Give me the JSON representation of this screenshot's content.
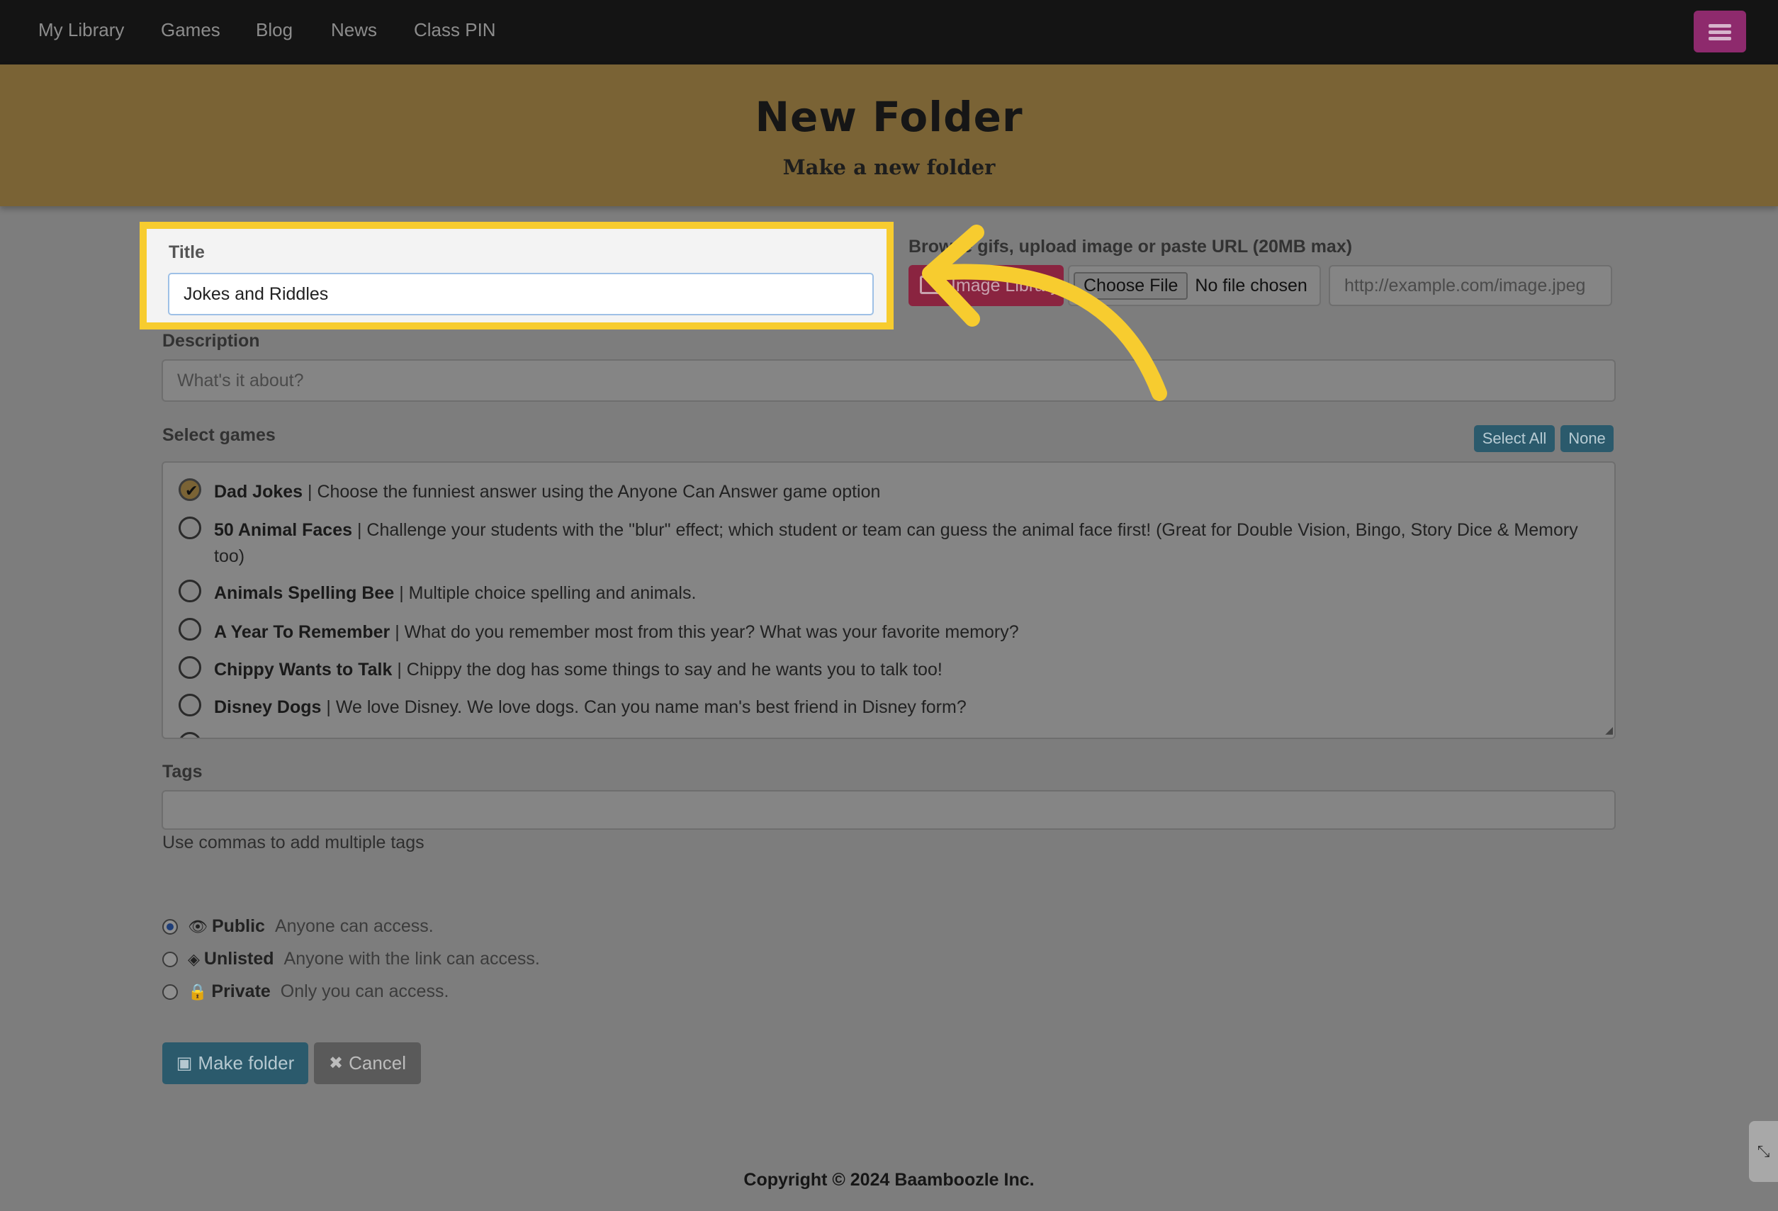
{
  "nav": {
    "items": [
      "My Library",
      "Games",
      "Blog",
      "News",
      "Class PIN"
    ]
  },
  "banner": {
    "title": "New Folder",
    "subtitle": "Make a new folder"
  },
  "form": {
    "title_label": "Title",
    "title_value": "Jokes and Riddles",
    "image_label": "Browse gifs, upload image or paste URL (20MB max)",
    "image_library_label": "Image Library",
    "choose_file_label": "Choose File",
    "no_file_label": "No file chosen",
    "url_placeholder": "http://example.com/image.jpeg",
    "description_label": "Description",
    "description_placeholder": "What's it about?",
    "select_games_label": "Select games",
    "select_all_label": "Select All",
    "none_label": "None",
    "games": [
      {
        "name": "Dad Jokes",
        "desc": " | Choose the funniest answer using the Anyone Can Answer game option",
        "checked": true
      },
      {
        "name": "50 Animal Faces",
        "desc": " | Challenge your students with the \"blur\" effect; which student or team can guess the animal face first! (Great for Double Vision, Bingo, Story Dice & Memory too)",
        "checked": false
      },
      {
        "name": "Animals Spelling Bee",
        "desc": " | Multiple choice spelling and animals.",
        "checked": false
      },
      {
        "name": "A Year To Remember",
        "desc": " | What do you remember most from this year? What was your favorite memory?",
        "checked": false
      },
      {
        "name": "Chippy Wants to Talk",
        "desc": " | Chippy the dog has some things to say and he wants you to talk too!",
        "checked": false
      },
      {
        "name": "Disney Dogs",
        "desc": " | We love Disney. We love dogs. Can you name man's best friend in Disney form?",
        "checked": false
      }
    ],
    "tags_label": "Tags",
    "tags_hint": "Use commas to add multiple tags",
    "visibility": [
      {
        "name": "Public",
        "desc": "Anyone can access.",
        "icon": "eye-icon",
        "checked": true
      },
      {
        "name": "Unlisted",
        "desc": "Anyone with the link can access.",
        "icon": "eye-slash-icon",
        "checked": false
      },
      {
        "name": "Private",
        "desc": "Only you can access.",
        "icon": "lock-icon",
        "checked": false
      }
    ],
    "make_folder_label": "Make folder",
    "cancel_label": "Cancel"
  },
  "footer": {
    "copyright": "Copyright © 2024 Baamboozle Inc."
  },
  "colors": {
    "banner": "#7a6335",
    "highlight": "#f7cc2f",
    "primary_button": "#2b5a6c",
    "menu_button": "#8e2a6d",
    "image_library_button": "#8a2440"
  }
}
